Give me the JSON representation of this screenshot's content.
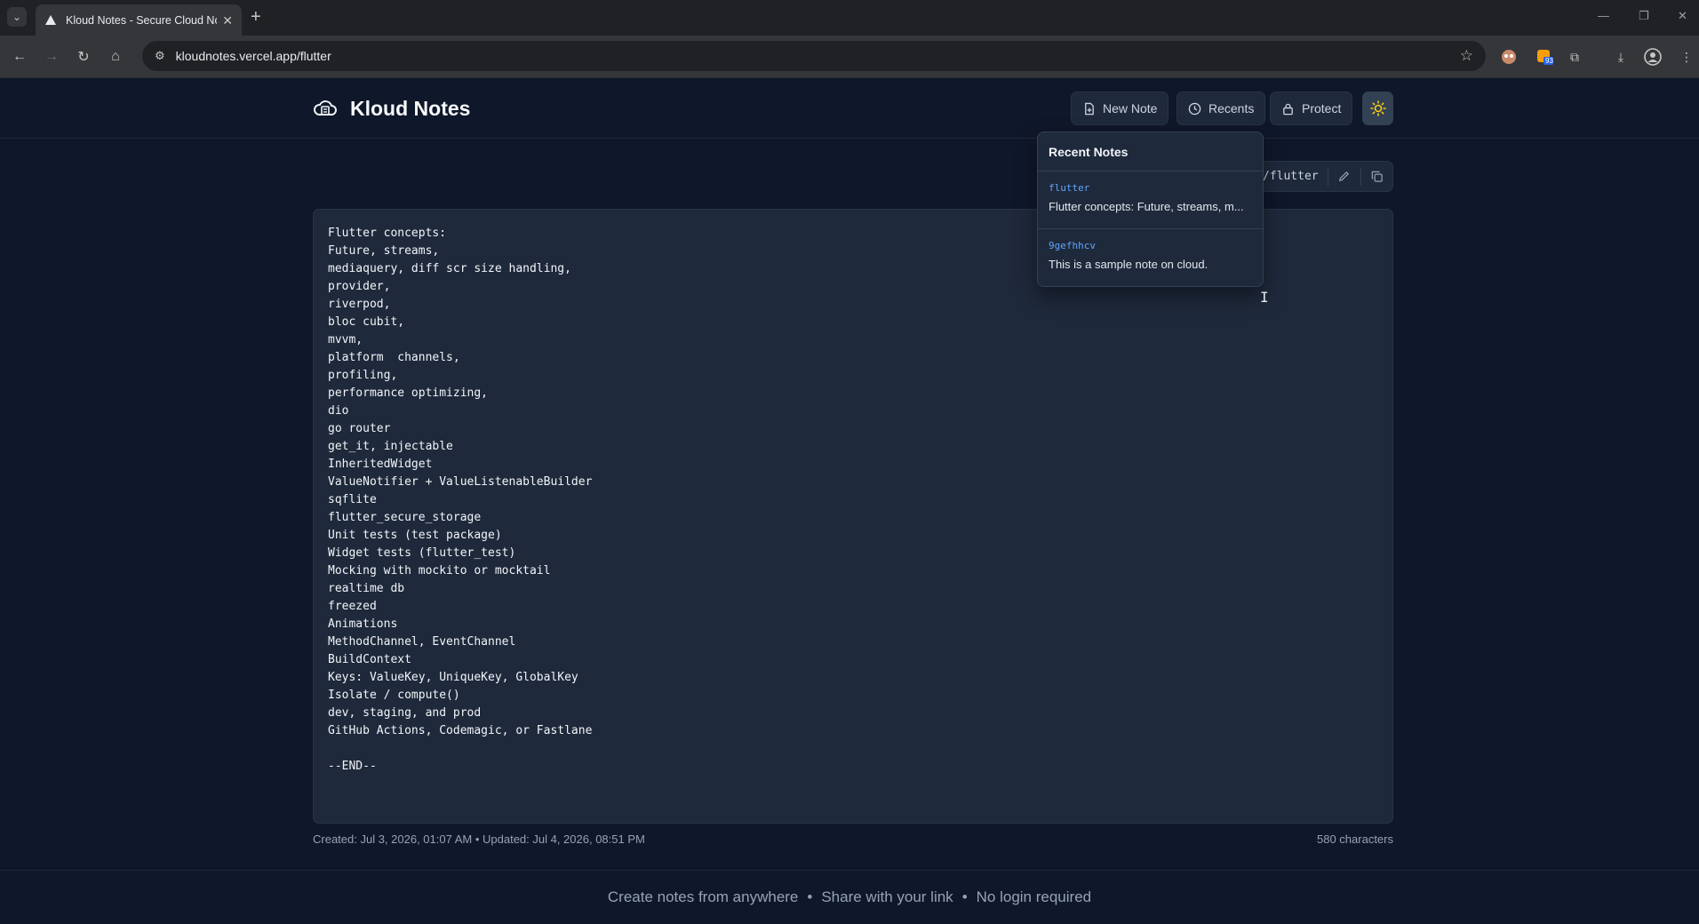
{
  "browser": {
    "tab_title": "Kloud Notes - Secure Cloud Notes",
    "url": "kloudnotes.vercel.app/flutter",
    "extension_badge": "93"
  },
  "header": {
    "app_title": "Kloud Notes",
    "new_note_label": "New Note",
    "recents_label": "Recents",
    "protect_label": "Protect"
  },
  "note": {
    "path": "/flutter",
    "content": "Flutter concepts:\nFuture, streams,\nmediaquery, diff scr size handling,\nprovider,\nriverpod,\nbloc cubit,\nmvvm,\nplatform  channels,\nprofiling,\nperformance optimizing,\ndio\ngo router\nget_it, injectable\nInheritedWidget\nValueNotifier + ValueListenableBuilder\nsqflite\nflutter_secure_storage\nUnit tests (test package)\nWidget tests (flutter_test)\nMocking with mockito or mocktail\nrealtime db\nfreezed\nAnimations\nMethodChannel, EventChannel\nBuildContext\nKeys: ValueKey, UniqueKey, GlobalKey\nIsolate / compute()\ndev, staging, and prod\nGitHub Actions, Codemagic, or Fastlane\n\n--END--",
    "meta": "Created: Jul 3, 2026, 01:07 AM • Updated: Jul 4, 2026, 08:51 PM",
    "char_count": "580 characters"
  },
  "recents": {
    "title": "Recent Notes",
    "items": [
      {
        "slug": "flutter",
        "preview": "Flutter concepts: Future, streams, m..."
      },
      {
        "slug": "9gefhhcv",
        "preview": "This is a sample note on cloud."
      }
    ]
  },
  "footer": {
    "part1": "Create notes from anywhere",
    "part2": "Share with your link",
    "part3": "No login required"
  },
  "colors": {
    "background": "#0f172a",
    "panel": "#1e293b",
    "accent_link": "#60a5fa",
    "theme_icon": "#facc15"
  }
}
